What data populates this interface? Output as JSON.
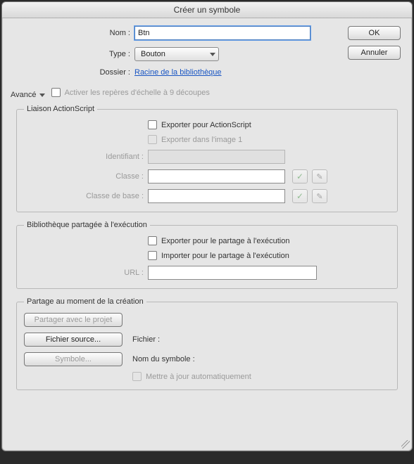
{
  "title": "Créer un symbole",
  "buttons": {
    "ok": "OK",
    "cancel": "Annuler"
  },
  "form": {
    "name_label": "Nom :",
    "name_value": "Btn",
    "type_label": "Type :",
    "type_value": "Bouton",
    "folder_label": "Dossier :",
    "folder_value": "Racine de la bibliothèque"
  },
  "advanced_label": "Avancé",
  "scale9": {
    "label": "Activer les repères d'échelle à 9 découpes"
  },
  "linkage": {
    "legend": "Liaison ActionScript",
    "export_as": "Exporter pour ActionScript",
    "export_frame1": "Exporter dans l'image 1",
    "identifier_label": "Identifiant :",
    "identifier_value": "",
    "class_label": "Classe :",
    "class_value": "",
    "baseclass_label": "Classe de base :",
    "baseclass_value": ""
  },
  "runtime": {
    "legend": "Bibliothèque partagée à l'exécution",
    "export": "Exporter pour le partage à l'exécution",
    "import": "Importer pour le partage à l'exécution",
    "url_label": "URL :",
    "url_value": ""
  },
  "authortime": {
    "legend": "Partage au moment de la création",
    "share_project": "Partager avec le projet",
    "source_file": "Fichier source...",
    "symbol": "Symbole...",
    "file_label": "Fichier :",
    "file_value": "",
    "symbolname_label": "Nom du symbole :",
    "symbolname_value": "",
    "auto_update": "Mettre à jour automatiquement"
  }
}
